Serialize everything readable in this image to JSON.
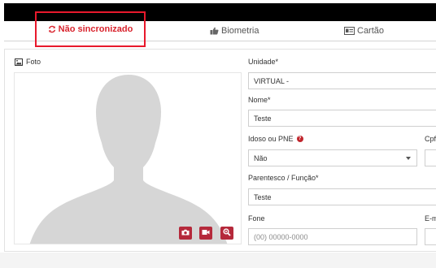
{
  "tabs": {
    "not_synced": "Não sincronizado",
    "biometrics": "Biometria",
    "card": "Cartão"
  },
  "photo": {
    "label": "Foto"
  },
  "form": {
    "unidade_label": "Unidade*",
    "unidade_value": "VIRTUAL -",
    "nome_label": "Nome*",
    "nome_value": "Teste",
    "idoso_label": "Idoso ou PNE",
    "idoso_value": "Não",
    "cpf_label": "Cpf",
    "parentesco_label": "Parentesco / Função*",
    "parentesco_value": "Teste",
    "fone_label": "Fone",
    "fone_placeholder": "(00) 00000-0000",
    "email_label": "E-m"
  },
  "colors": {
    "accent_red": "#d9232d",
    "button_red": "#b5293b",
    "highlight_border": "#e8192c"
  },
  "icons": {
    "sync": "sync-icon",
    "thumb": "thumbs-up-icon",
    "card": "id-card-icon",
    "image": "image-icon",
    "camera": "camera-icon",
    "video": "video-camera-icon",
    "zoom": "zoom-icon",
    "info": "info-icon"
  }
}
